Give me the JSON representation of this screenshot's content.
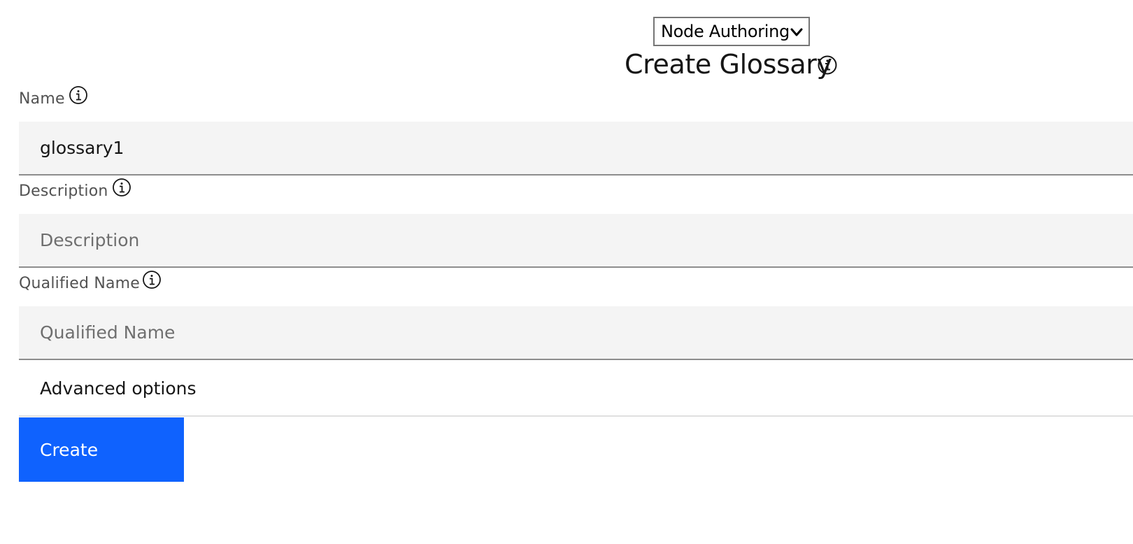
{
  "header": {
    "mode_select": {
      "selected": "Node Authoring",
      "icon": "chevron-down-icon"
    },
    "title": "Create Glossary",
    "title_icon": "info-icon"
  },
  "form": {
    "name": {
      "label": "Name",
      "value": "glossary1",
      "icon": "info-icon"
    },
    "description": {
      "label": "Description",
      "value": "",
      "placeholder": "Description",
      "icon": "info-icon"
    },
    "qualified_name": {
      "label": "Qualified Name",
      "value": "",
      "placeholder": "Qualified Name",
      "icon": "info-icon"
    },
    "advanced_options_label": "Advanced options",
    "create_button_label": "Create"
  },
  "colors": {
    "primary_button": "#0f62fe",
    "input_background": "#f4f4f4",
    "input_border": "#8d8d8d",
    "label_text": "#525252",
    "placeholder_text": "#6f6f6f"
  }
}
